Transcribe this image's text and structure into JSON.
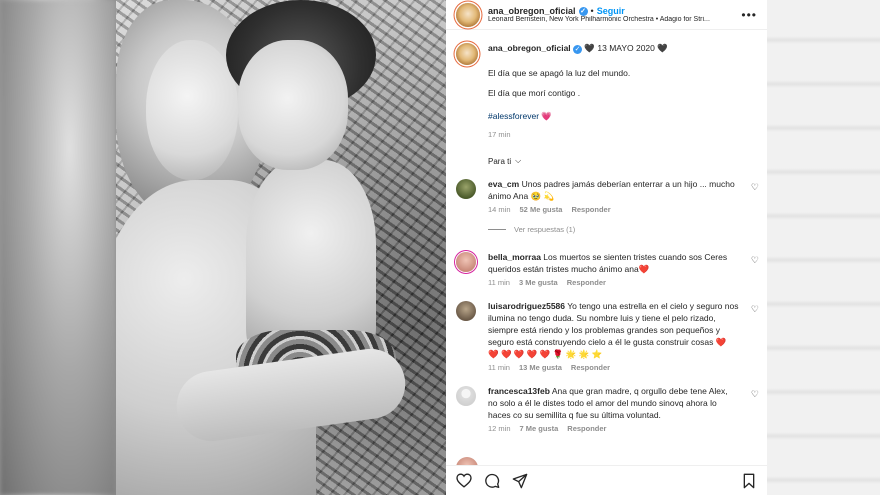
{
  "header": {
    "username": "ana_obregon_oficial",
    "verified_mark": "✓",
    "separator": "•",
    "follow_label": "Seguir",
    "audio": "Leonard Bernstein, New York Philharmonic Orchestra • Adagio for Stri...",
    "more_label": "•••"
  },
  "caption": {
    "username": "ana_obregon_oficial",
    "date_text": "13 MAYO 2020",
    "line1": "El día que se apagó la luz del mundo.",
    "line2": "El día que morí contigo .",
    "hashtag": "#alessforever",
    "time": "17 min"
  },
  "filter": {
    "label": "Para ti"
  },
  "comments": [
    {
      "user": "eva_cm",
      "text": "Unos padres jamás deberían enterrar a un hijo ... mucho ánimo Ana 🥹 💫",
      "time": "14 min",
      "likes": "52 Me gusta",
      "reply": "Responder",
      "replies_label": "Ver respuestas (1)",
      "avatar_color": "#4a5a2a"
    },
    {
      "user": "bella_morraa",
      "text": "Los muertos se sienten tristes cuando sos Ceres queridos están tristes mucho ánimo ana❤️",
      "time": "11 min",
      "likes": "3 Me gusta",
      "reply": "Responder",
      "avatar_color": "#c98a7a"
    },
    {
      "user": "luisarodriguez5586",
      "text": "Yo tengo una estrella en el cielo y seguro nos ilumina no tengo duda. Su nombre luis y tiene el pelo rizado, siempre está riendo y los problemas grandes son pequeños y seguro está construyendo cielo a él le gusta construir cosas ❤️ ❤️ ❤️ ❤️ ❤️ ❤️ 🌹 🌟 🌟 ⭐",
      "time": "11 min",
      "likes": "13 Me gusta",
      "reply": "Responder",
      "avatar_color": "#6b5a48"
    },
    {
      "user": "francesca13feb",
      "text": "Ana que gran madre, q orgullo debe tene Alex, no solo a él le distes todo el amor del mundo sinovq ahora lo haces co su semillita q fue su última voluntad.",
      "time": "12 min",
      "likes": "7 Me gusta",
      "reply": "Responder",
      "avatar_color": "#dcdcdc"
    }
  ],
  "icons": {
    "heart": "heart-icon",
    "comment": "comment-icon",
    "share": "share-icon",
    "save": "bookmark-icon",
    "more": "more-icon",
    "verified": "verified-icon",
    "chevron": "chevron-down-icon"
  },
  "colors": {
    "accent": "#0095f6",
    "verified": "#3897f0",
    "hashtag": "#00376b",
    "secondary_text": "#8e8e8e",
    "heart": "#e0245e"
  }
}
